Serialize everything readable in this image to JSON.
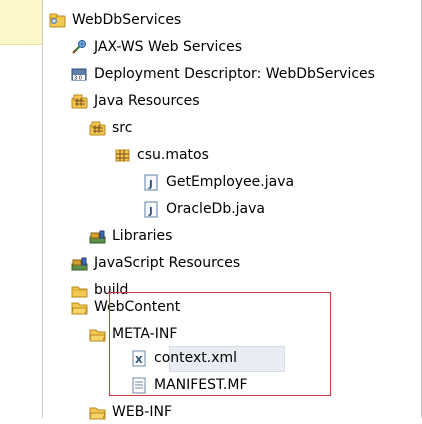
{
  "tree": {
    "project": {
      "label": "WebDbServices",
      "icon": "project-folder-icon"
    },
    "items": [
      {
        "label": "JAX-WS Web Services",
        "icon": "web-services-icon"
      },
      {
        "label": "Deployment Descriptor: WebDbServices",
        "icon": "deployment-descriptor-icon"
      },
      {
        "label": "Java Resources",
        "icon": "java-resources-icon"
      },
      {
        "label": "src",
        "icon": "source-folder-icon"
      },
      {
        "label": "csu.matos",
        "icon": "package-icon"
      },
      {
        "label": "GetEmployee.java",
        "icon": "java-file-icon"
      },
      {
        "label": "OracleDb.java",
        "icon": "java-file-icon"
      },
      {
        "label": "Libraries",
        "icon": "library-icon"
      },
      {
        "label": "JavaScript Resources",
        "icon": "javascript-resources-icon"
      },
      {
        "label": "build",
        "icon": "folder-icon"
      },
      {
        "label": "WebContent",
        "icon": "folder-open-icon"
      },
      {
        "label": "META-INF",
        "icon": "folder-open-icon"
      },
      {
        "label": "context.xml",
        "icon": "xml-file-icon"
      },
      {
        "label": "MANIFEST.MF",
        "icon": "text-file-icon"
      },
      {
        "label": "WEB-INF",
        "icon": "folder-open-icon"
      }
    ]
  },
  "colors": {
    "highlight_border": "#d7363f",
    "folder": "#f2c94c",
    "selected_bg": "#e9ecf3"
  }
}
